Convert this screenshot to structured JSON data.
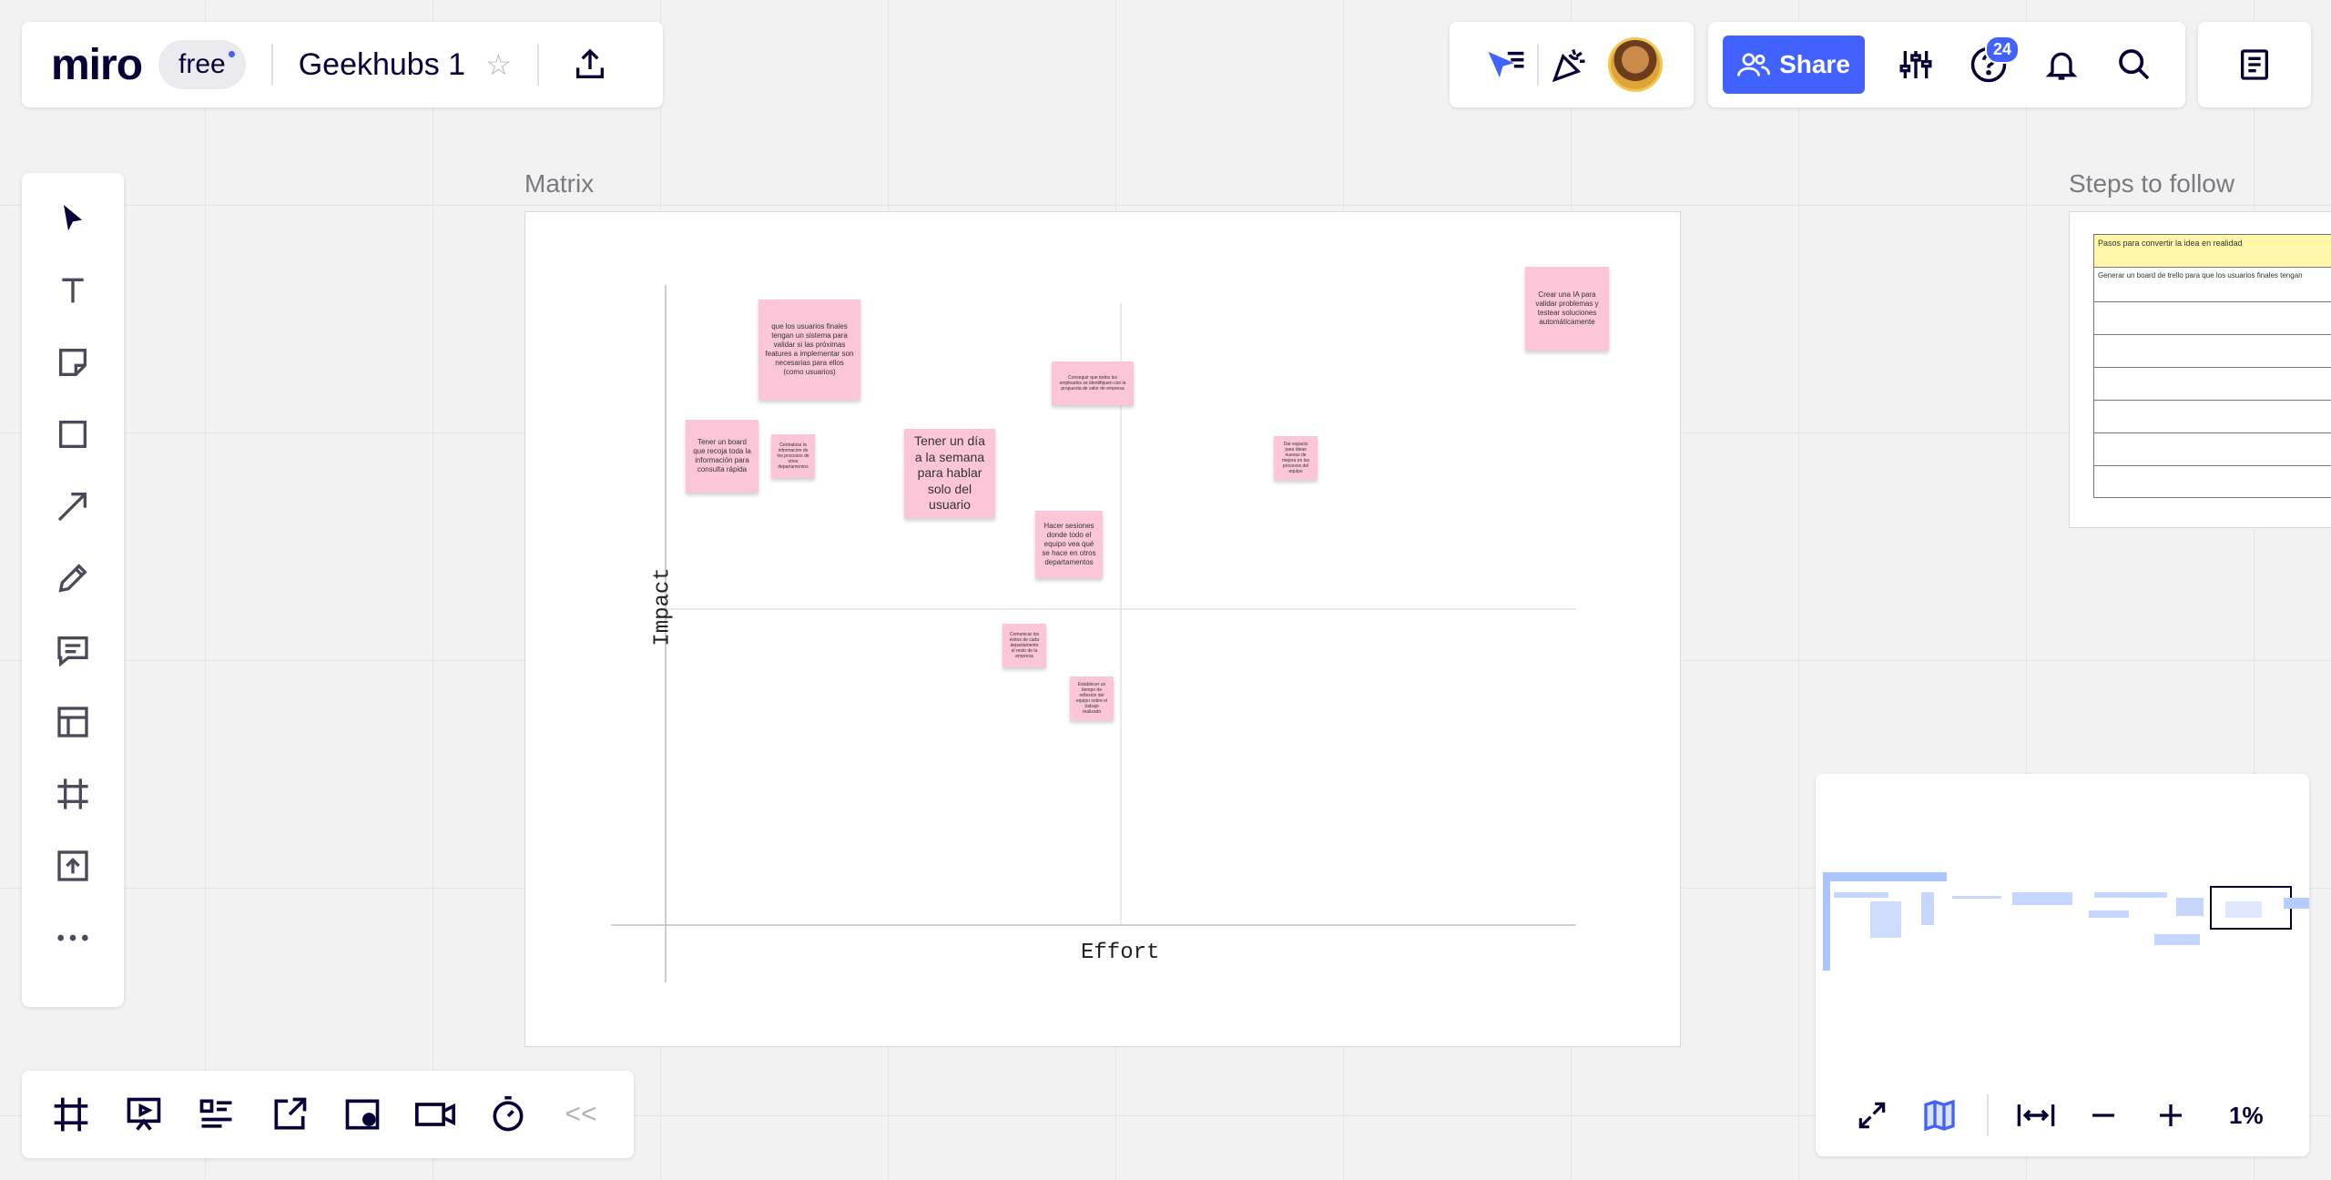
{
  "header": {
    "logo": "miro",
    "plan": "free",
    "board_name": "Geekhubs 1",
    "share_label": "Share",
    "help_badge": "24"
  },
  "toolbar": {
    "tools": [
      "select-tool",
      "text-tool",
      "sticky-note-tool",
      "shape-tool",
      "connection-line-tool",
      "pen-tool",
      "comment-tool",
      "templates-tool",
      "frame-tool",
      "upload-tool",
      "more-tools"
    ]
  },
  "bottom_toolbar": {
    "items": [
      "frames-panel",
      "presentation-mode",
      "card-list",
      "embed",
      "screen-record",
      "video-chat",
      "timer"
    ],
    "collapse_label": "<<"
  },
  "minimap": {
    "zoom_label": "1%"
  },
  "matrix": {
    "title": "Matrix",
    "x_axis": "Effort",
    "y_axis": "Impact",
    "stickies": [
      {
        "text": "que los usuarios finales tengan un sistema para validar si las próximas features a implementar son necesarias para ellos (como usuarios)"
      },
      {
        "text": "Tener un board que recoja toda la información para consulta rápida"
      },
      {
        "text": "Centralizar la información de los procesos de otros departamentos"
      },
      {
        "text": "Tener un día a la semana para hablar solo del usuario"
      },
      {
        "text": "Conseguir que todos los empleados se identifiquen con la propuesta de valor de empresa"
      },
      {
        "text": "Hacer sesiones donde todo el equipo vea qué se hace en otros departamentos"
      },
      {
        "text": "Dar espacio para ideas nuevas de mejora en los procesos del equipo"
      },
      {
        "text": "Crear una IA para validar problemas y testear soluciones automáticamente"
      },
      {
        "text": "Comunicar los éxitos de cada departamento al resto de la empresa"
      },
      {
        "text": "Establecer un tiempo de reflexión del equipo sobre el trabajo realizado"
      }
    ]
  },
  "steps": {
    "title": "Steps to follow",
    "header_row": "Pasos para convertir la idea en realidad",
    "first_row": "Generar un board de trello para que los usuarios finales tengan"
  }
}
